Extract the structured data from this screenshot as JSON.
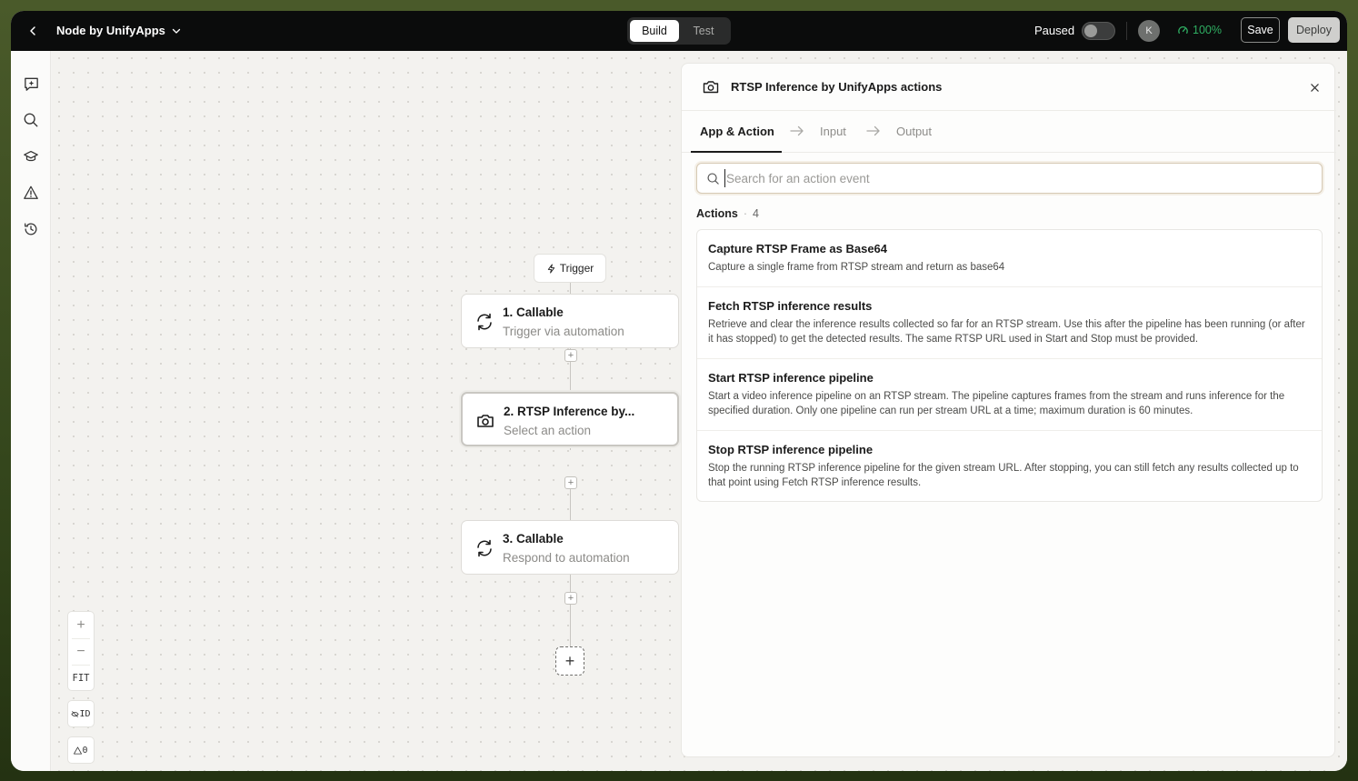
{
  "topbar": {
    "app_title": "Node by UnifyApps",
    "modes": [
      {
        "label": "Build",
        "active": true
      },
      {
        "label": "Test",
        "active": false
      }
    ],
    "paused_label": "Paused",
    "paused_on": false,
    "avatar_initial": "K",
    "health_percent": "100%",
    "save_label": "Save",
    "deploy_label": "Deploy"
  },
  "rail": {
    "icons": [
      "sparkle-chat-icon",
      "search-icon",
      "graduation-cap-icon",
      "warning-icon",
      "history-icon"
    ]
  },
  "canvas": {
    "trigger_label": "Trigger",
    "nodes": [
      {
        "title": "1. Callable",
        "subtitle": "Trigger via automation",
        "icon": "refresh-icon",
        "selected": false
      },
      {
        "title": "2. RTSP Inference by...",
        "subtitle": "Select an action",
        "icon": "camera-icon",
        "selected": true
      },
      {
        "title": "3. Callable",
        "subtitle": "Respond to automation",
        "icon": "refresh-icon",
        "selected": false
      }
    ],
    "zoom_in": "+",
    "zoom_out": "−",
    "fit_label": "FIT",
    "id_label": "ID",
    "warning_count": "0"
  },
  "panel": {
    "title": "RTSP Inference by UnifyApps actions",
    "tabs": [
      {
        "label": "App & Action",
        "active": true
      },
      {
        "label": "Input",
        "active": false
      },
      {
        "label": "Output",
        "active": false
      }
    ],
    "search_placeholder": "Search for an action event",
    "search_value": "",
    "actions_title": "Actions",
    "actions_count": "4",
    "actions": [
      {
        "title": "Capture RTSP Frame as Base64",
        "desc": "Capture a single frame from RTSP stream and return as base64"
      },
      {
        "title": "Fetch RTSP inference results",
        "desc": "Retrieve and clear the inference results collected so far for an RTSP stream. Use this after the pipeline has been running (or after it has stopped) to get the detected results. The same RTSP URL used in Start and Stop must be provided."
      },
      {
        "title": "Start RTSP inference pipeline",
        "desc": "Start a video inference pipeline on an RTSP stream. The pipeline captures frames from the stream and runs inference for the specified duration. Only one pipeline can run per stream URL at a time; maximum duration is 60 minutes."
      },
      {
        "title": "Stop RTSP inference pipeline",
        "desc": "Stop the running RTSP inference pipeline for the given stream URL. After stopping, you can still fetch any results collected up to that point using Fetch RTSP inference results."
      }
    ]
  },
  "colors": {
    "topbar_bg": "#0b0c0c",
    "health_green": "#2fae62",
    "canvas_bg": "#f3f2ef",
    "search_border": "#d6c9b4"
  }
}
